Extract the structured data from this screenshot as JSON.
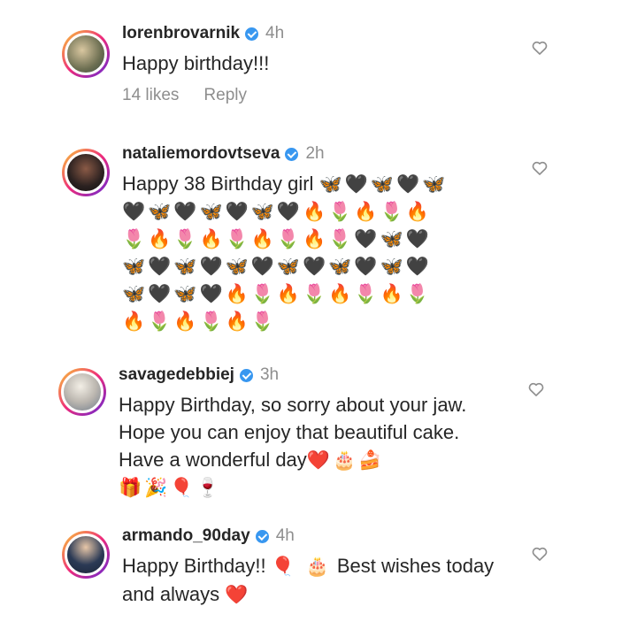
{
  "comments": [
    {
      "username": "lorenbrovarnik",
      "time": "4h",
      "text": "Happy birthday!!!",
      "likes": "14 likes",
      "reply": "Reply"
    },
    {
      "username": "nataliemordovtseva",
      "time": "2h",
      "text": "Happy 38 Birthday girl",
      "emoji_rows": [
        "🦋🖤🦋🖤🦋",
        "🖤🦋🖤🦋🖤🦋🖤🔥🌷🔥🌷🔥",
        "🌷🔥🌷🔥🌷🔥🌷🔥🌷🖤🦋🖤",
        "🦋🖤🦋🖤🦋🖤🦋🖤🦋🖤🦋🖤",
        "🦋🖤🦋🖤🔥🌷🔥🌷🔥🌷🔥🌷",
        "🔥🌷🔥🌷🔥🌷"
      ]
    },
    {
      "username": "savagedebbiej",
      "time": "3h",
      "text": "Happy Birthday, so sorry about your jaw. Hope you can enjoy that beautiful cake. Have a wonderful day",
      "emoji_tail": "❤️🎂🍰",
      "emoji_line2": "🎁🎉🎈🍷"
    },
    {
      "username": "armando_90day",
      "time": "4h",
      "text_part1": "Happy Birthday!!",
      "emoji_mid": "🎈 🎂",
      "text_part2": "Best wishes today and always",
      "emoji_end": "❤️"
    }
  ],
  "colors": {
    "text": "#262626",
    "muted": "#8e8e8e",
    "verified": "#3897f0"
  },
  "icons": [
    "verified-badge-icon",
    "heart-outline-icon"
  ]
}
